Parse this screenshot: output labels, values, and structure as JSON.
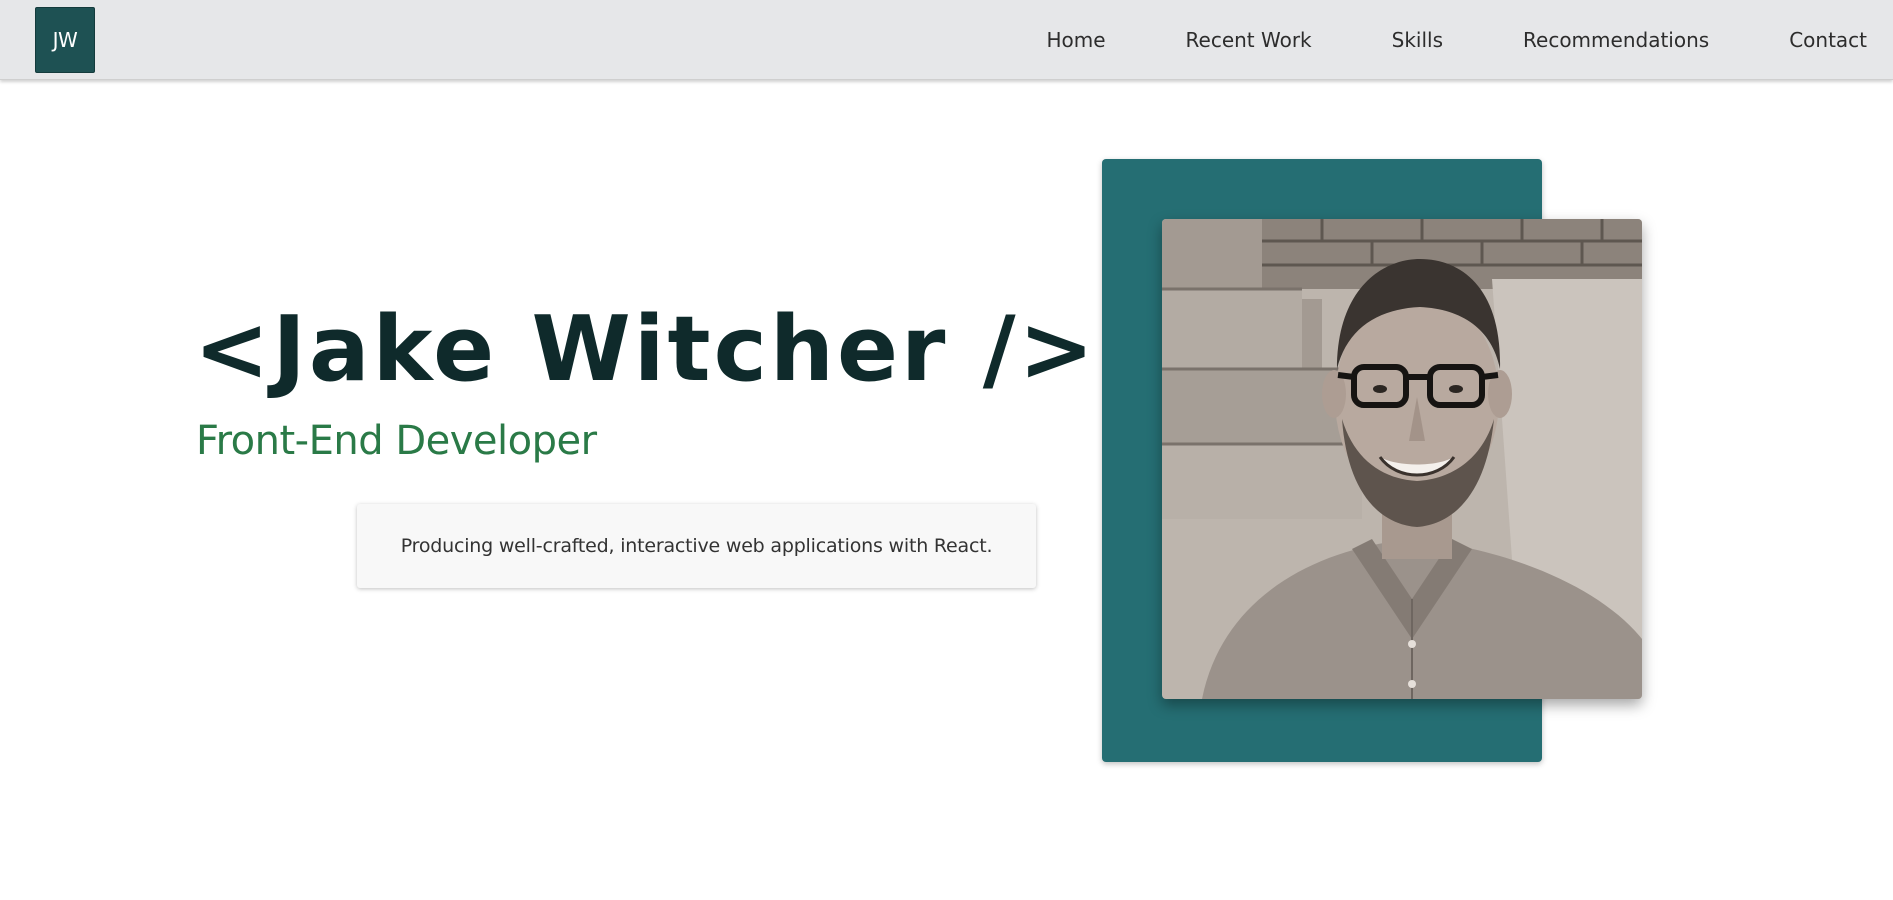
{
  "nav": {
    "logo_text": "JW",
    "links": [
      {
        "label": "Home"
      },
      {
        "label": "Recent Work"
      },
      {
        "label": "Skills"
      },
      {
        "label": "Recommendations"
      },
      {
        "label": "Contact"
      }
    ]
  },
  "hero": {
    "name": "<Jake Witcher />",
    "role": "Front-End Developer",
    "tagline": "Producing well-crafted, interactive web applications with React."
  },
  "colors": {
    "logo_bg": "#1e5153",
    "name": "#0f2a2b",
    "role": "#2a7a47",
    "teal_block": "#256e73",
    "navbar_bg": "#e6e7e9"
  }
}
